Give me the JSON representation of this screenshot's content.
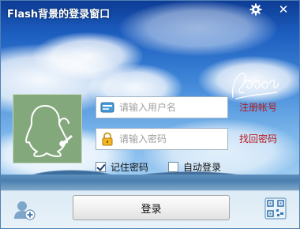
{
  "window": {
    "title": "Flash背景的登录窗口",
    "controls": {
      "settings_icon": "gear-icon",
      "close_icon": "close-icon",
      "close_glyph": "✕"
    }
  },
  "login": {
    "avatar_icon": "qq-penguin-avatar-icon",
    "username": {
      "placeholder": "请输入用户名",
      "value": "",
      "icon": "user-card-icon"
    },
    "password": {
      "placeholder": "请输入密码",
      "value": "",
      "icon": "lock-icon"
    },
    "register_link": "注册帐号",
    "recover_link": "找回密码",
    "remember_password": {
      "label": "记住密码",
      "checked": true
    },
    "auto_login": {
      "label": "自动登录",
      "checked": false
    },
    "submit_label": "登录"
  },
  "footer": {
    "add_account_icon": "add-account-icon",
    "qr_icon": "qr-code-icon"
  },
  "colors": {
    "link": "#b4191f",
    "sky_top": "#0d3c96",
    "sky_bottom": "#a9d2f3",
    "avatar_bg": "#83a87b"
  }
}
